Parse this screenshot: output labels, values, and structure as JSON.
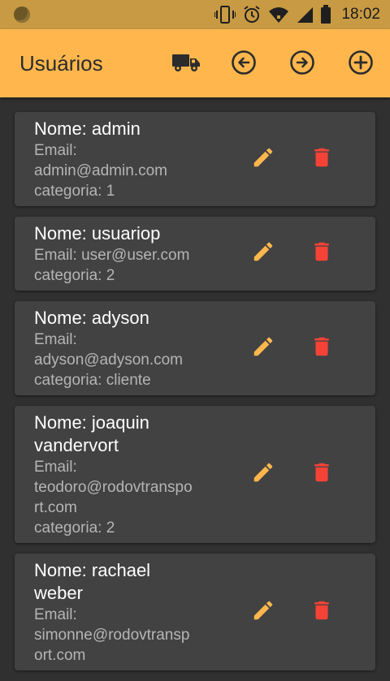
{
  "status_bar": {
    "time": "18:02",
    "icons": [
      "vibrate-icon",
      "alarm-icon",
      "wifi-icon",
      "signal-icon",
      "battery-icon"
    ]
  },
  "app_bar": {
    "title": "Usuários",
    "actions": [
      "truck-icon",
      "arrow-back-circle-icon",
      "arrow-forward-circle-icon",
      "add-circle-icon"
    ]
  },
  "colors": {
    "accent": "#ffb74d",
    "status_bar": "#c79a43",
    "background": "#303030",
    "card": "#424242",
    "edit_icon": "#ffb74d",
    "delete_icon": "#f44336"
  },
  "users": [
    {
      "name_lines": [
        "Nome: admin"
      ],
      "detail_lines": [
        "Email:",
        "admin@admin.com",
        "categoria: 1"
      ]
    },
    {
      "name_lines": [
        "Nome: usuariop"
      ],
      "detail_lines": [
        "Email: user@user.com",
        "categoria: 2"
      ]
    },
    {
      "name_lines": [
        "Nome: adyson"
      ],
      "detail_lines": [
        "Email:",
        "adyson@adyson.com",
        "categoria: cliente"
      ]
    },
    {
      "name_lines": [
        "Nome: joaquin",
        "vandervort"
      ],
      "detail_lines": [
        "Email:",
        "teodoro@rodovtranspo",
        "rt.com",
        "categoria: 2"
      ]
    },
    {
      "name_lines": [
        "Nome: rachael",
        "weber"
      ],
      "detail_lines": [
        "Email:",
        "simonne@rodovtransp",
        "ort.com"
      ]
    }
  ]
}
